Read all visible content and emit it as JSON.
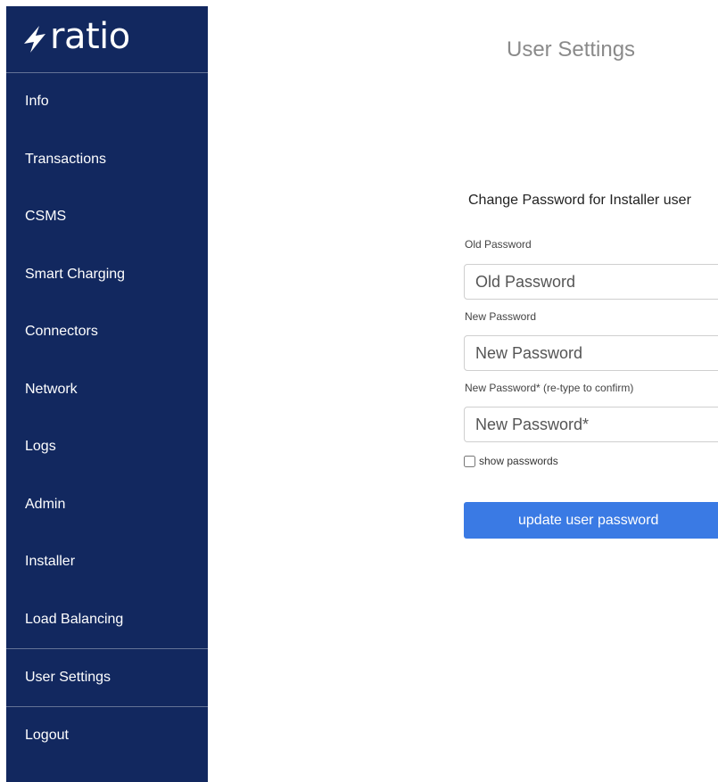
{
  "app": {
    "brand": "ratio",
    "brand_icon": "lightning-bolt-icon",
    "colors": {
      "sidebar": "#12285f",
      "accent": "#3a7ae4"
    }
  },
  "sidebar": {
    "items": [
      {
        "label": "Info"
      },
      {
        "label": "Transactions"
      },
      {
        "label": "CSMS"
      },
      {
        "label": "Smart Charging"
      },
      {
        "label": "Connectors"
      },
      {
        "label": "Network"
      },
      {
        "label": "Logs"
      },
      {
        "label": "Admin"
      },
      {
        "label": "Installer"
      },
      {
        "label": "Load Balancing"
      },
      {
        "label": "User Settings"
      },
      {
        "label": "Logout"
      }
    ]
  },
  "main": {
    "title": "User Settings",
    "section_heading": "Change Password for Installer user",
    "old_password": {
      "label": "Old Password",
      "placeholder": "Old Password",
      "value": ""
    },
    "new_password": {
      "label": "New Password",
      "placeholder": "New Password",
      "value": ""
    },
    "confirm_password": {
      "label": "New Password* (re-type to confirm)",
      "placeholder": "New Password*",
      "value": ""
    },
    "show_passwords": {
      "label": "show passwords",
      "checked": false
    },
    "update_button": "update user password"
  }
}
